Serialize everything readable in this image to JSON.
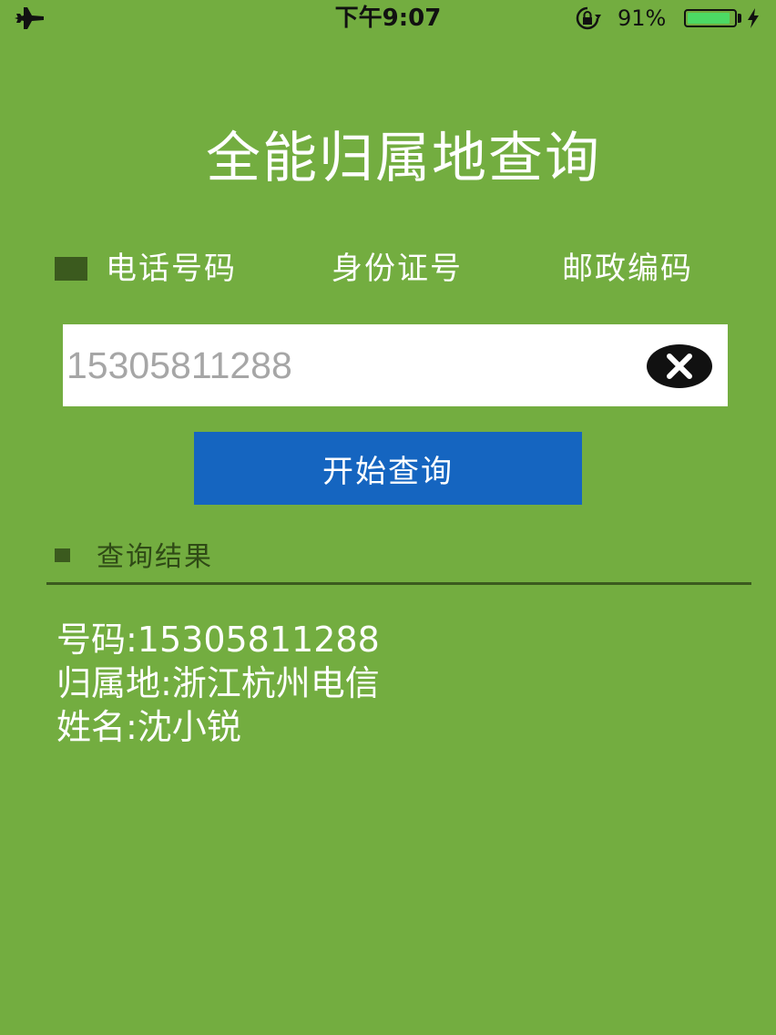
{
  "status_bar": {
    "time": "下午9:07",
    "battery_percent": "91%",
    "battery_level": 0.91,
    "icons": [
      "airplane-icon",
      "rotation-lock-icon",
      "battery-icon",
      "charging-icon"
    ],
    "battery_fill_color": "#4cd964"
  },
  "app": {
    "title": "全能归属地查询"
  },
  "tabs": [
    {
      "label": "电话号码",
      "selected": true
    },
    {
      "label": "身份证号",
      "selected": false
    },
    {
      "label": "邮政编码",
      "selected": false
    }
  ],
  "search": {
    "value": "15305811288",
    "clear_icon": "clear-icon"
  },
  "query_button": {
    "label": "开始查询"
  },
  "results": {
    "heading": "查询结果",
    "lines": [
      "号码:15305811288",
      "归属地:浙江杭州电信",
      "姓名:沈小锐"
    ]
  },
  "colors": {
    "background": "#73ad40",
    "marker": "#3b5a1e",
    "button": "#1565c0",
    "text": "#ffffff"
  }
}
